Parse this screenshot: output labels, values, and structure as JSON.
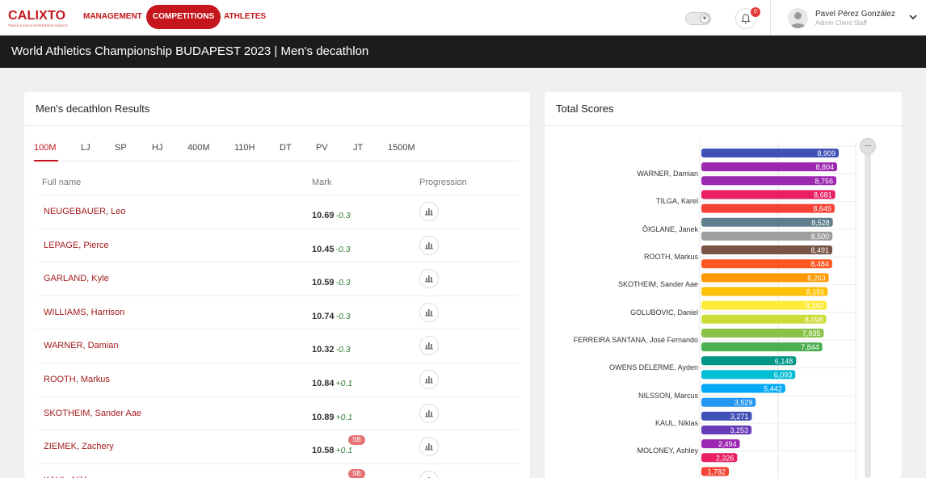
{
  "nav": {
    "logo": "CALIXTO",
    "logo_sub": "TRACK & FIELD EXPERIENCE EVENTS",
    "items": [
      "MANAGEMENT",
      "COMPETITIONS",
      "ATHLETES"
    ],
    "active": "COMPETITIONS",
    "theme_toggle_icon": "sun-icon",
    "notification_count": "0",
    "user_name": "Pavel Pérez González",
    "user_role": "Admin Client Staff"
  },
  "page_title": "World Athletics Championship BUDAPEST 2023 | Men's decathlon",
  "results": {
    "title": "Men's decathlon Results",
    "tabs": [
      "100M",
      "LJ",
      "SP",
      "HJ",
      "400M",
      "110H",
      "DT",
      "PV",
      "JT",
      "1500M"
    ],
    "active_tab": "100M",
    "columns": [
      "Full name",
      "Mark",
      "Progression"
    ],
    "rows": [
      {
        "name": "NEUGEBAUER, Leo",
        "mark": "10.69",
        "wind": "-0.3",
        "badge": ""
      },
      {
        "name": "LEPAGE, Pierce",
        "mark": "10.45",
        "wind": "-0.3",
        "badge": ""
      },
      {
        "name": "GARLAND, Kyle",
        "mark": "10.59",
        "wind": "-0.3",
        "badge": ""
      },
      {
        "name": "WILLIAMS, Harrison",
        "mark": "10.74",
        "wind": "-0.3",
        "badge": ""
      },
      {
        "name": "WARNER, Damian",
        "mark": "10.32",
        "wind": "-0.3",
        "badge": ""
      },
      {
        "name": "ROOTH, Markus",
        "mark": "10.84",
        "wind": "+0.1",
        "badge": ""
      },
      {
        "name": "SKOTHEIM, Sander Aae",
        "mark": "10.89",
        "wind": "+0.1",
        "badge": ""
      },
      {
        "name": "ZIEMEK, Zachery",
        "mark": "10.58",
        "wind": "+0.1",
        "badge": "SB"
      },
      {
        "name": "KAUL, Niklas",
        "mark": "",
        "wind": "",
        "badge": "SB"
      }
    ]
  },
  "scores": {
    "title": "Total Scores"
  },
  "chart_data": {
    "type": "bar",
    "orientation": "horizontal",
    "title": "Total Scores",
    "category_labels": [
      "WARNER, Damian",
      "TILGA, Karel",
      "ÕIGLANE, Janek",
      "ROOTH, Markus",
      "SKOTHEIM, Sander Aae",
      "GOLUBOVIC, Daniel",
      "FERREIRA SANTANA, José Fernando",
      "OWENS DELERME, Ayden",
      "NILSSON, Marcus",
      "KAUL, Niklas",
      "MOLONEY, Ashley"
    ],
    "values": [
      8909,
      8804,
      8756,
      8681,
      8645,
      8528,
      8500,
      8491,
      8484,
      8263,
      8191,
      8142,
      8098,
      7935,
      7844,
      6148,
      6093,
      5442,
      3529,
      3271,
      3253,
      2494,
      2326,
      1782
    ],
    "value_labels": [
      "8,909",
      "8,804",
      "8,756",
      "8,681",
      "8,645",
      "8,528",
      "8,500",
      "8,491",
      "8,484",
      "8,263",
      "8,191",
      "8,142",
      "8,098",
      "7,935",
      "7,844",
      "6,148",
      "6,093",
      "5,442",
      "3,529",
      "3,271",
      "3,253",
      "2,494",
      "2,326",
      "1,782"
    ],
    "colors": [
      "#3f51b5",
      "#9c27b0",
      "#9c27b0",
      "#e91e63",
      "#f44336",
      "#607d8b",
      "#9e9e9e",
      "#795548",
      "#ff5722",
      "#ff9800",
      "#ffc107",
      "#ffeb3b",
      "#cddc39",
      "#8bc34a",
      "#4caf50",
      "#009688",
      "#00bcd4",
      "#03a9f4",
      "#2196f3",
      "#3f51b5",
      "#673ab7",
      "#9c27b0",
      "#e91e63",
      "#f44336"
    ],
    "xlim": [
      0,
      9000
    ]
  }
}
